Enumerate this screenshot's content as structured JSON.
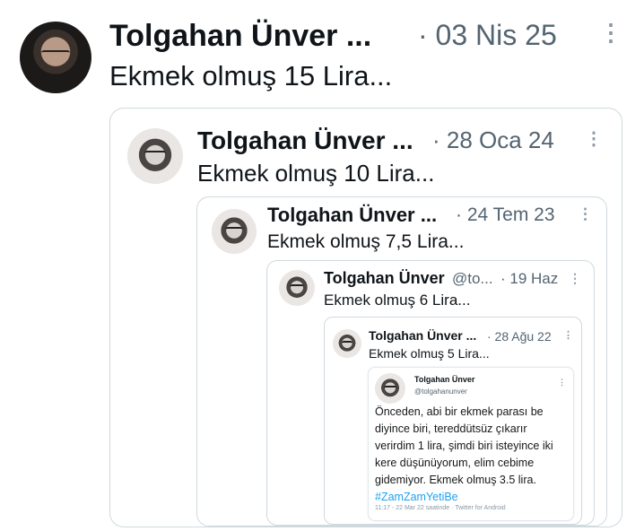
{
  "tweet": {
    "author": "Tolgahan Ünver ...",
    "date": "· 03 Nis 25",
    "text": "Ekmek olmuş 15 Lira...",
    "more": "⋮"
  },
  "quote1": {
    "author": "Tolgahan Ünver ...",
    "date": "· 28 Oca 24",
    "text": "Ekmek olmuş 10 Lira...",
    "more": "⋮"
  },
  "quote2": {
    "author": "Tolgahan Ünver ...",
    "date": "· 24 Tem 23",
    "text": "Ekmek olmuş 7,5 Lira...",
    "more": "⋮"
  },
  "quote3": {
    "author": "Tolgahan Ünver",
    "handle": "@to...",
    "date": "· 19 Haz",
    "text": "Ekmek olmuş 6 Lira...",
    "more": "⋮"
  },
  "quote4": {
    "author": "Tolgahan Ünver ...",
    "date": "· 28 Ağu 22",
    "text": "Ekmek olmuş 5 Lira...",
    "more": "⋮"
  },
  "original": {
    "author": "Tolgahan Ünver",
    "handle": "@tolgahanunver",
    "text": "Önceden, abi bir ekmek parası be diyince biri, tereddütsüz çıkarır verirdim 1 lira, şimdi biri isteyince iki kere düşünüyorum, elim cebime gidemiyor. Ekmek olmuş 3.5 lira.",
    "hashtag": "#ZamZamYetiBe",
    "footer": "11:17 - 22 Mar 22 saatinde · Twitter for Android",
    "more": "⋮"
  }
}
